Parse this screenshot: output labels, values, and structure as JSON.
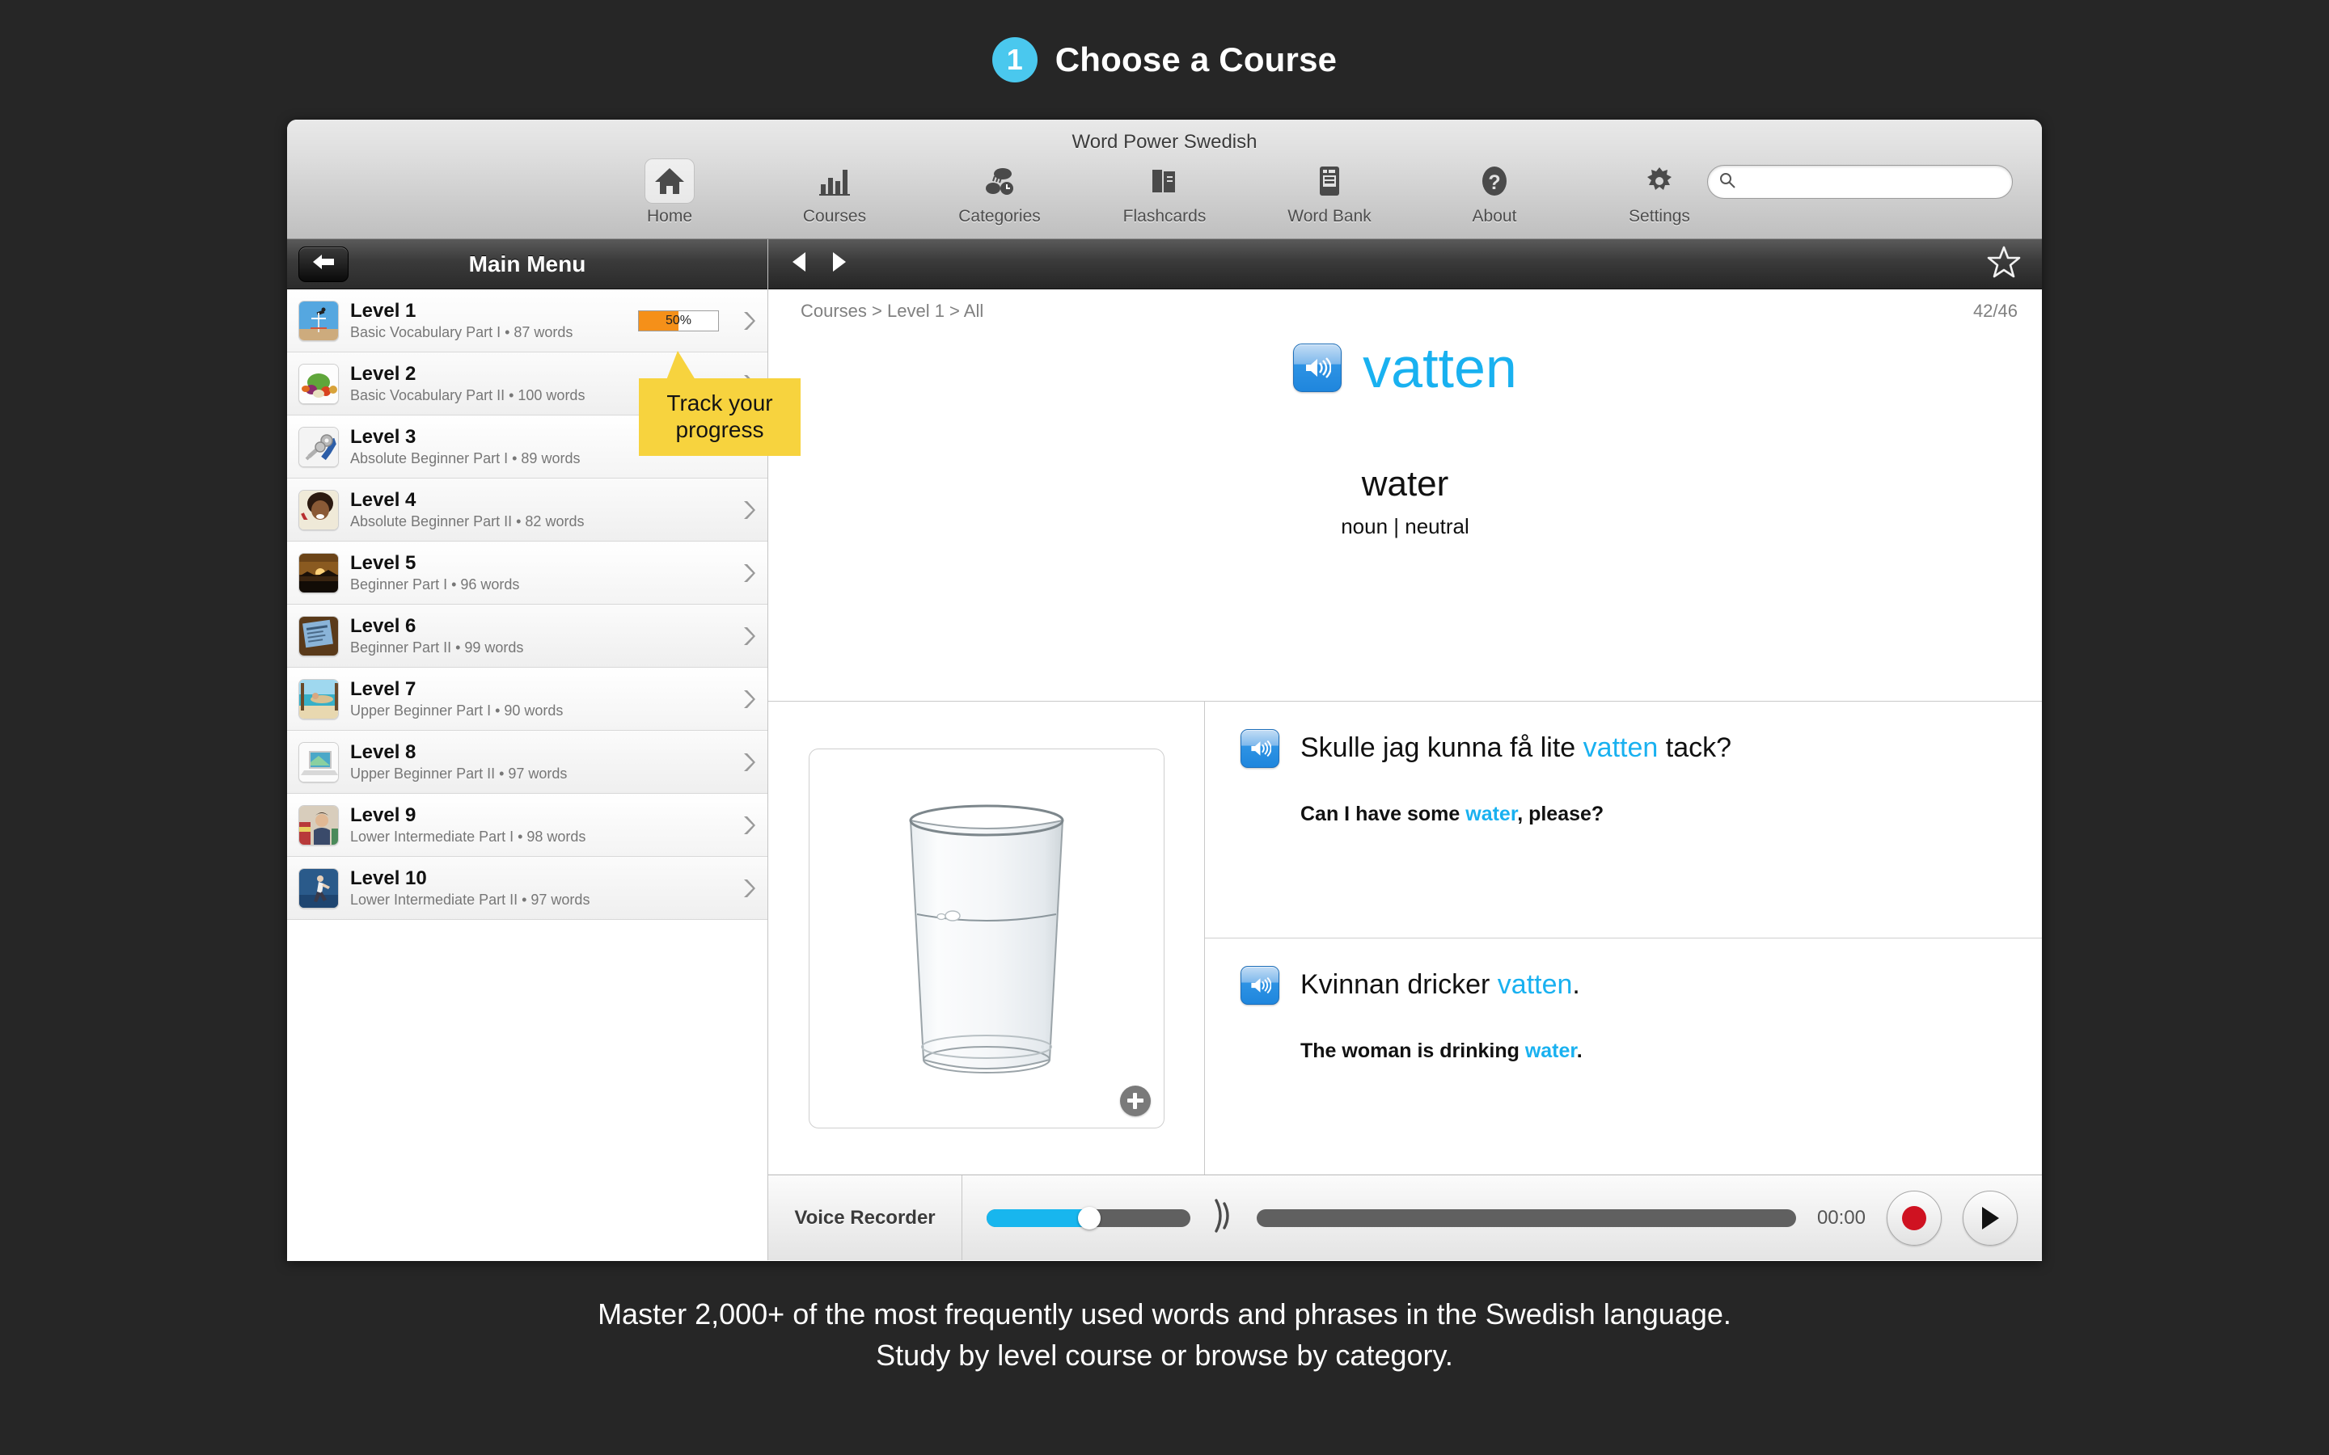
{
  "promo": {
    "step_number": "1",
    "title": "Choose a Course",
    "caption_line1": "Master 2,000+ of the most frequently used words and phrases in the Swedish language.",
    "caption_line2": "Study by level course or browse by category.",
    "accent_blue": "#4ac8ee",
    "background": "#262626"
  },
  "app": {
    "title": "Word Power Swedish"
  },
  "toolbar": {
    "items": [
      {
        "label": "Home",
        "icon": "home-icon",
        "selected": true
      },
      {
        "label": "Courses",
        "icon": "bar-chart-icon",
        "selected": false
      },
      {
        "label": "Categories",
        "icon": "categories-icon",
        "selected": false
      },
      {
        "label": "Flashcards",
        "icon": "flashcards-icon",
        "selected": false
      },
      {
        "label": "Word Bank",
        "icon": "word-bank-icon",
        "selected": false
      },
      {
        "label": "About",
        "icon": "question-icon",
        "selected": false
      },
      {
        "label": "Settings",
        "icon": "gear-icon",
        "selected": false
      }
    ],
    "search": {
      "value": "",
      "placeholder": "",
      "icon": "search-icon"
    }
  },
  "sidebar": {
    "title": "Main Menu",
    "back_icon": "back-arrow-icon",
    "levels": [
      {
        "name": "Level 1",
        "subtitle": "Basic Vocabulary Part I • 87 words",
        "progress": 50,
        "progress_label": "50%",
        "thumb": "hurdle-jumper-thumb"
      },
      {
        "name": "Level 2",
        "subtitle": "Basic Vocabulary Part II • 100 words",
        "progress": null,
        "progress_label": "",
        "thumb": "vegetables-thumb"
      },
      {
        "name": "Level 3",
        "subtitle": "Absolute Beginner Part I • 89 words",
        "progress": null,
        "progress_label": "",
        "thumb": "keys-thumb"
      },
      {
        "name": "Level 4",
        "subtitle": "Absolute Beginner Part II • 82 words",
        "progress": null,
        "progress_label": "",
        "thumb": "girl-brushing-teeth-thumb"
      },
      {
        "name": "Level 5",
        "subtitle": "Beginner Part I • 96 words",
        "progress": null,
        "progress_label": "",
        "thumb": "sunset-thumb"
      },
      {
        "name": "Level 6",
        "subtitle": "Beginner Part II • 99 words",
        "progress": null,
        "progress_label": "",
        "thumb": "newspaper-thumb"
      },
      {
        "name": "Level 7",
        "subtitle": "Upper Beginner Part I • 90 words",
        "progress": null,
        "progress_label": "",
        "thumb": "beach-hammock-thumb"
      },
      {
        "name": "Level 8",
        "subtitle": "Upper Beginner Part II • 97 words",
        "progress": null,
        "progress_label": "",
        "thumb": "laptop-thumb"
      },
      {
        "name": "Level 9",
        "subtitle": "Lower Intermediate Part I • 98 words",
        "progress": null,
        "progress_label": "",
        "thumb": "man-market-thumb"
      },
      {
        "name": "Level 10",
        "subtitle": "Lower Intermediate Part II • 97 words",
        "progress": null,
        "progress_label": "",
        "thumb": "runner-thumb"
      }
    ]
  },
  "callout": {
    "line1": "Track your",
    "line2": "progress",
    "color": "#f7d33e"
  },
  "content": {
    "prev_icon": "prev-arrow-icon",
    "next_icon": "next-arrow-icon",
    "star_icon": "star-outline-icon",
    "breadcrumb": "Courses > Level 1 > All",
    "counter": "42/46",
    "word": {
      "target": "vatten",
      "translation": "water",
      "part_of_speech": "noun | neutral",
      "target_color": "#19b1f0",
      "audio_icon": "speaker-icon"
    },
    "image": {
      "alt": "glass-of-water-image",
      "zoom_icon": "plus-circle-icon"
    },
    "sentences": [
      {
        "target_pre": "Skulle jag kunna få lite ",
        "target_hl": "vatten",
        "target_post": " tack?",
        "trans_pre": "Can I have some ",
        "trans_hl": "water",
        "trans_post": ", please?",
        "audio_icon": "speaker-icon"
      },
      {
        "target_pre": "Kvinnan dricker ",
        "target_hl": "vatten",
        "target_post": ".",
        "trans_pre": "The woman is drinking ",
        "trans_hl": "water",
        "trans_post": ".",
        "audio_icon": "speaker-icon"
      }
    ]
  },
  "recorder": {
    "label": "Voice Recorder",
    "volume_percent": 48,
    "time": "00:00",
    "record_icon": "record-icon",
    "play_icon": "play-icon",
    "wave_icon": "sound-wave-icon"
  }
}
